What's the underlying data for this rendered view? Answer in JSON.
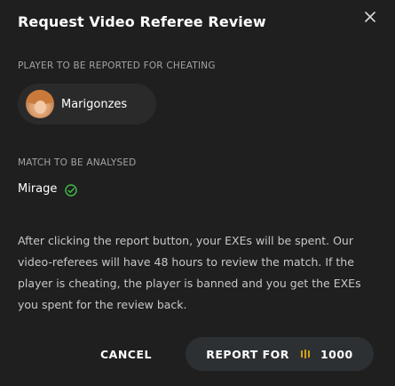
{
  "modal": {
    "title": "Request Video Referee Review"
  },
  "player_section": {
    "label": "PLAYER TO BE REPORTED FOR CHEATING",
    "player_name": "Marigonzes"
  },
  "match_section": {
    "label": "MATCH TO BE ANALYSED",
    "map_name": "Mirage"
  },
  "description": "After clicking the report button, your EXEs will be spent. Our video-referees will have 48 hours to review the match. If the player is cheating, the player is banned and you get the EXEs you spent for the review back.",
  "actions": {
    "cancel_label": "CANCEL",
    "report_label": "REPORT FOR",
    "report_cost": "1000"
  },
  "icons": {
    "close": "close-icon",
    "check": "check-circle-icon",
    "coin": "exe-coin-icon"
  },
  "colors": {
    "background": "#1f1f1f",
    "check_green": "#3fbf4a",
    "coin_gold": "#d4a017"
  }
}
